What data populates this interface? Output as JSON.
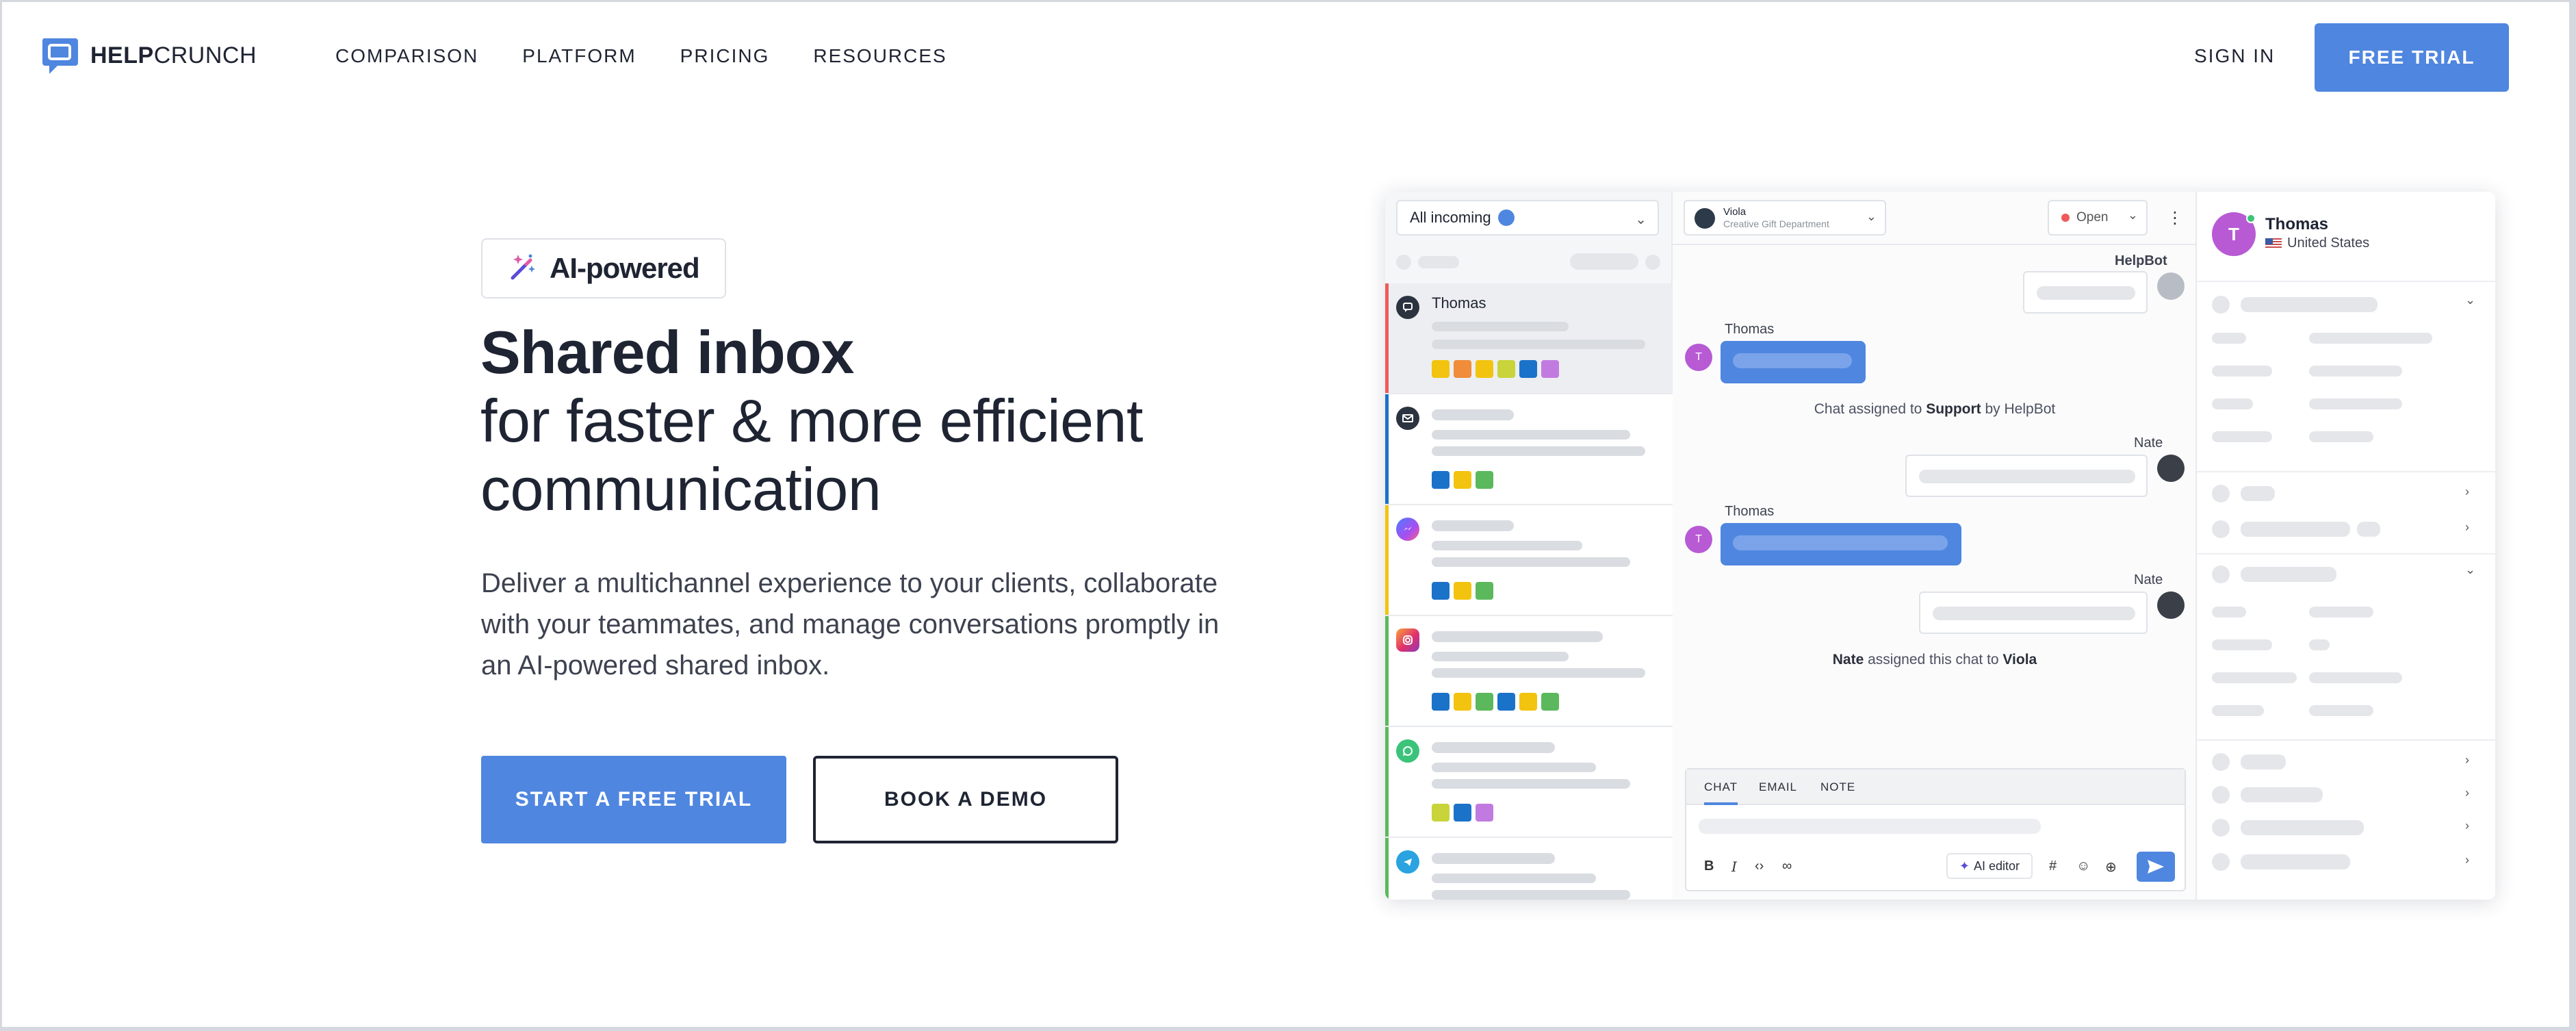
{
  "header": {
    "logo": {
      "bold": "HELP",
      "regular": "CRUNCH"
    },
    "nav": [
      "COMPARISON",
      "PLATFORM",
      "PRICING",
      "RESOURCES"
    ],
    "sign_in": "SIGN IN",
    "free_trial": "FREE TRIAL"
  },
  "hero": {
    "badge": "AI-powered",
    "title": "Shared inbox",
    "subtitle_line1": "for faster & more efficient",
    "subtitle_line2": "communication",
    "description": "Deliver a multichannel experience to your clients, collaborate with your teammates, and manage conversations promptly in an AI-powered shared inbox.",
    "cta_primary": "START A FREE TRIAL",
    "cta_secondary": "BOOK A DEMO"
  },
  "app": {
    "filter": "All incoming",
    "conversations": [
      {
        "channel": "chat",
        "name": "Thomas",
        "tags": [
          "#f2c40f",
          "#f08c3a",
          "#f2c40f",
          "#c8d43a",
          "#1b72c9",
          "#c17be0"
        ]
      },
      {
        "channel": "email",
        "name": "",
        "tags": [
          "#1b72c9",
          "#f2c40f",
          "#5cb85c"
        ]
      },
      {
        "channel": "messenger",
        "name": "",
        "tags": [
          "#1b72c9",
          "#f2c40f",
          "#5cb85c"
        ]
      },
      {
        "channel": "instagram",
        "name": "",
        "tags": [
          "#1b72c9",
          "#f2c40f",
          "#5cb85c",
          "#1b72c9",
          "#f2c40f",
          "#5cb85c"
        ]
      },
      {
        "channel": "whatsapp",
        "name": "",
        "tags": [
          "#c8d43a",
          "#1b72c9",
          "#c17be0"
        ]
      },
      {
        "channel": "telegram",
        "name": "",
        "tags": []
      }
    ],
    "chat": {
      "agent_name": "Viola",
      "agent_dept": "Creative Gift Department",
      "status": "Open",
      "helpbot": "HelpBot",
      "customer": "Thomas",
      "agent2": "Nate",
      "system1_pre": "Chat assigned to ",
      "system1_bold1": "Support",
      "system1_mid": " by HelpBot",
      "system2_bold1": "Nate",
      "system2_mid": " assigned this chat to ",
      "system2_bold2": "Viola",
      "avatar_initial": "T"
    },
    "composer": {
      "tabs": [
        "CHAT",
        "EMAIL",
        "NOTE"
      ],
      "ai_editor": "AI editor"
    },
    "info": {
      "name": "Thomas",
      "country": "United States",
      "initial": "T"
    }
  }
}
